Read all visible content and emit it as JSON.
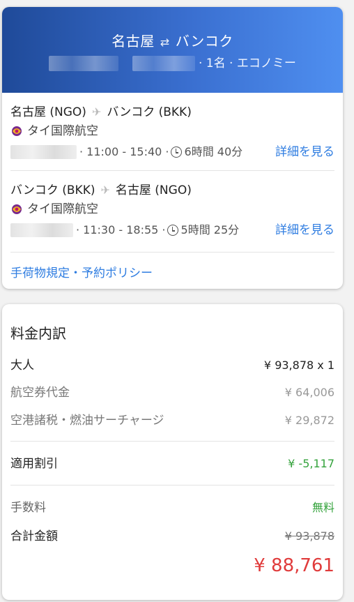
{
  "header": {
    "origin": "名古屋",
    "swap_icon": "⇄",
    "destination": "バンコク",
    "summary": "· 1名 · エコノミー"
  },
  "flights": [
    {
      "from": "名古屋 (NGO)",
      "to": "バンコク (BKK)",
      "airline": "タイ国際航空",
      "times": "· 11:00 - 15:40 ·",
      "duration": "6時間 40分",
      "details_label": "詳細を見る"
    },
    {
      "from": "バンコク (BKK)",
      "to": "名古屋 (NGO)",
      "airline": "タイ国際航空",
      "times": "· 11:30 - 18:55 ·",
      "duration": "5時間 25分",
      "details_label": "詳細を見る"
    }
  ],
  "policy_link": "手荷物規定・予約ポリシー",
  "price": {
    "title": "料金内訳",
    "adult_label": "大人",
    "adult_value": "¥ 93,878 x 1",
    "fare_label": "航空券代金",
    "fare_value": "¥ 64,006",
    "tax_label": "空港諸税・燃油サーチャージ",
    "tax_value": "¥ 29,872",
    "discount_label": "適用割引",
    "discount_value": "¥ -5,117",
    "fee_label": "手数料",
    "fee_value": "無料",
    "total_label": "合計金額",
    "original_total": "¥ 93,878",
    "total": "¥ 88,761"
  },
  "colors": {
    "header_start": "#1f4a99",
    "header_end": "#4f8ff0",
    "link": "#2f7de1",
    "discount": "#35a33d",
    "total": "#e03b3b"
  }
}
